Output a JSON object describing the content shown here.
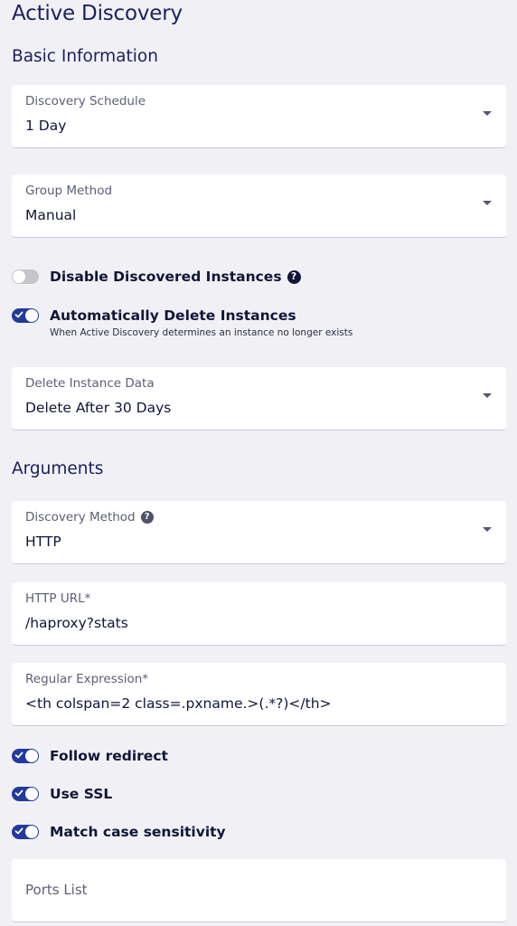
{
  "page": {
    "title": "Active Discovery"
  },
  "basic_information": {
    "heading": "Basic Information",
    "discovery_schedule": {
      "label": "Discovery Schedule",
      "value": "1 Day"
    },
    "group_method": {
      "label": "Group Method",
      "value": "Manual"
    },
    "disable_discovered_instances": {
      "label": "Disable Discovered Instances",
      "enabled": false,
      "help_icon": "question-circle-icon"
    },
    "auto_delete_instances": {
      "label": "Automatically Delete Instances",
      "enabled": true,
      "helper": "When Active Discovery determines an instance no longer exists"
    },
    "delete_instance_data": {
      "label": "Delete Instance Data",
      "value": "Delete After 30 Days"
    }
  },
  "arguments": {
    "heading": "Arguments",
    "discovery_method": {
      "label": "Discovery Method",
      "value": "HTTP",
      "help_icon": "question-circle-icon"
    },
    "http_url": {
      "label": "HTTP URL*",
      "value": "/haproxy?stats"
    },
    "regular_expression": {
      "label": "Regular Expression*",
      "value": "<th colspan=2 class=.pxname.>(.*?)</th>"
    },
    "follow_redirect": {
      "label": "Follow redirect",
      "enabled": true
    },
    "use_ssl": {
      "label": "Use SSL",
      "enabled": true
    },
    "match_case_sensitivity": {
      "label": "Match case sensitivity",
      "enabled": true
    },
    "ports_list": {
      "label": "Ports List",
      "value": ""
    }
  },
  "colors": {
    "background": "#f1f1f5",
    "accent": "#233a9b",
    "heading": "#1c2160",
    "toggle_off": "#c5c6cc"
  }
}
